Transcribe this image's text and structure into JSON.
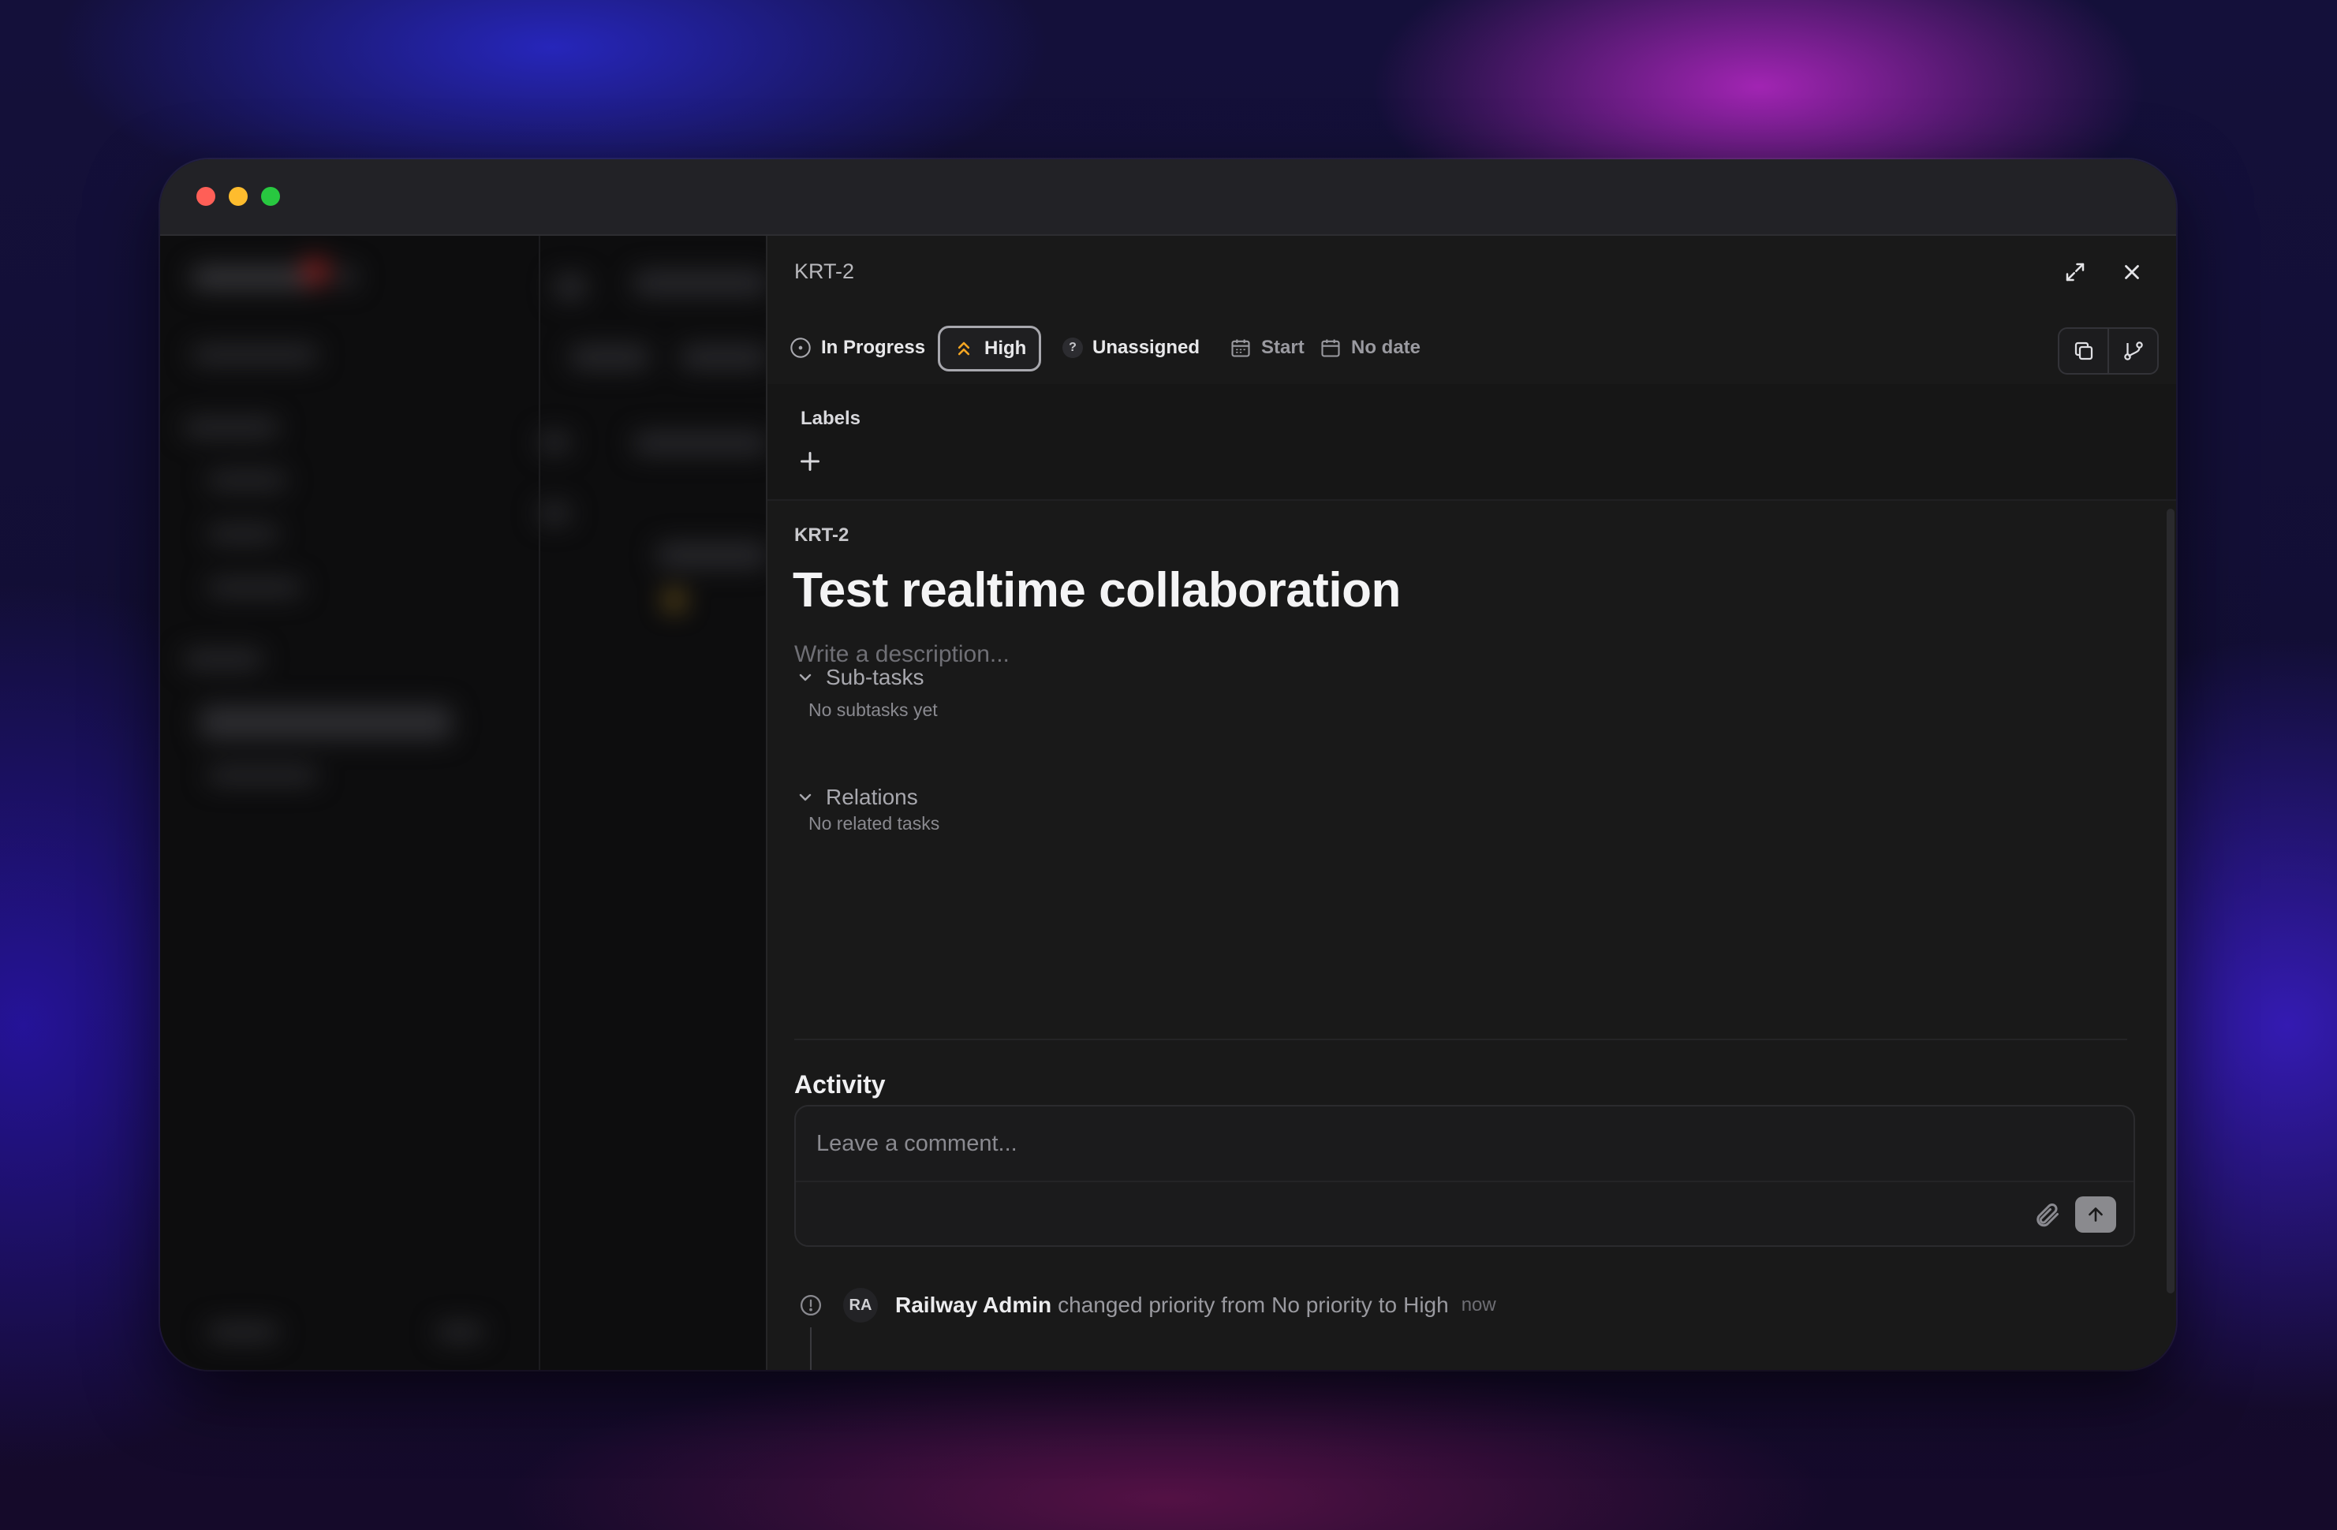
{
  "window": {
    "controls": [
      "close",
      "minimize",
      "zoom"
    ]
  },
  "header": {
    "issue_id": "KRT-2",
    "icons": [
      "expand-icon",
      "close-icon"
    ]
  },
  "toolbar": {
    "status": "In Progress",
    "priority": "High",
    "assignee": "Unassigned",
    "assignee_icon_glyph": "?",
    "start": "Start",
    "due": "No date",
    "actions": [
      "copy-icon",
      "branch-icon"
    ]
  },
  "labels": {
    "title": "Labels"
  },
  "issue": {
    "id": "KRT-2",
    "title": "Test realtime collaboration",
    "description_placeholder": "Write a description..."
  },
  "subtasks": {
    "title": "Sub-tasks",
    "empty": "No subtasks yet"
  },
  "relations": {
    "title": "Relations",
    "empty": "No related tasks"
  },
  "activity": {
    "title": "Activity",
    "comment_placeholder": "Leave a comment...",
    "entries": [
      {
        "avatar": "RA",
        "actor": "Railway Admin",
        "text_1": "changed priority from",
        "from": "No priority",
        "text_2": "to",
        "to": "High",
        "time": "now"
      }
    ]
  },
  "colors": {
    "priority_high": "#f5a623",
    "accent_bg": "#191919"
  }
}
